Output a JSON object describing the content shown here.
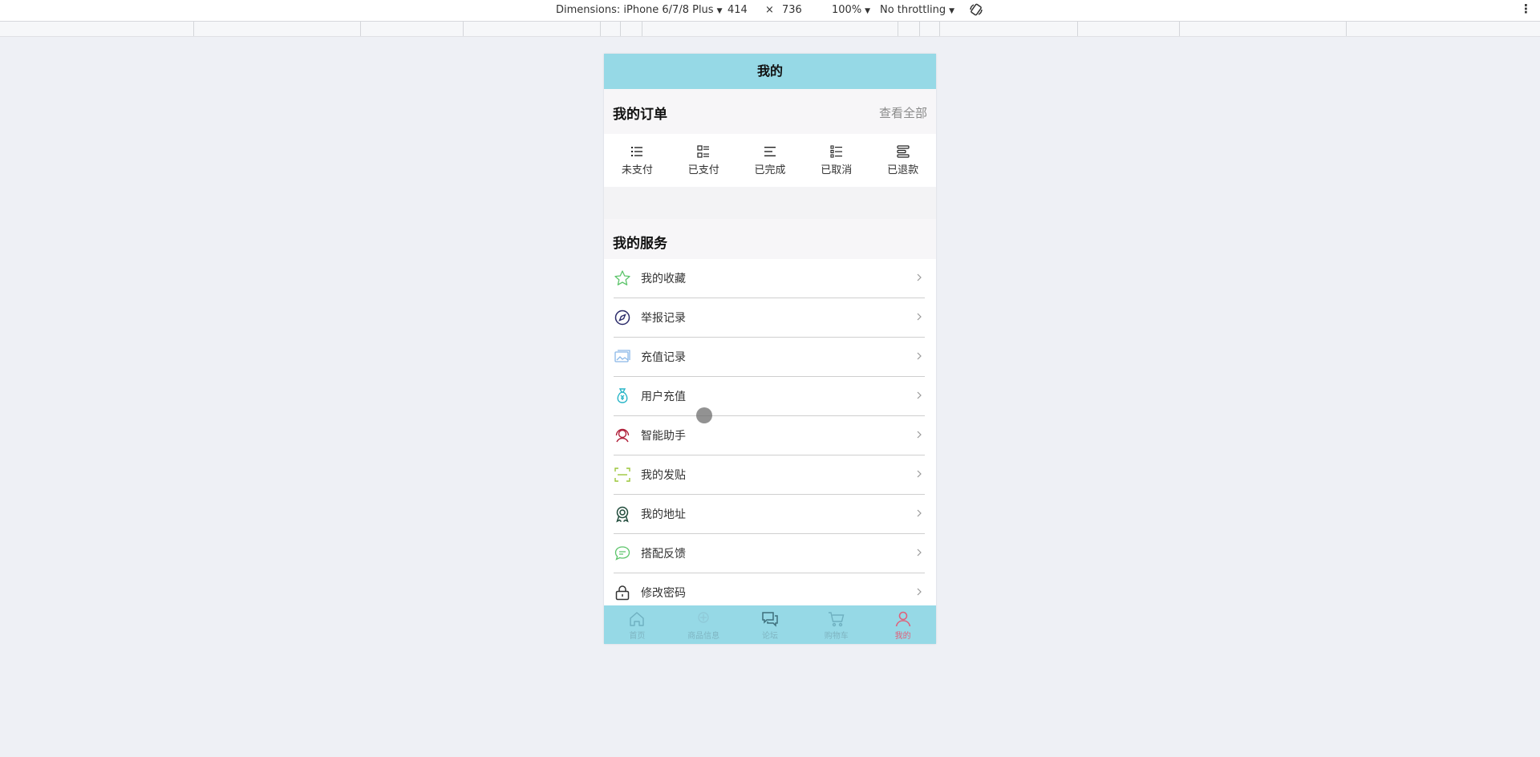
{
  "devtools": {
    "dimensions_label": "Dimensions: iPhone 6/7/8 Plus",
    "width": "414",
    "times": "×",
    "height": "736",
    "zoom": "100%",
    "throttling": "No throttling",
    "rotate_icon": "rotate-icon",
    "menu_icon": "more-vertical-icon"
  },
  "header": {
    "title": "我的"
  },
  "orders": {
    "title": "我的订单",
    "view_all": "查看全部",
    "items": [
      {
        "label": "未支付",
        "icon": "list-icon"
      },
      {
        "label": "已支付",
        "icon": "grid-list-icon"
      },
      {
        "label": "已完成",
        "icon": "align-left-icon"
      },
      {
        "label": "已取消",
        "icon": "checklist-icon"
      },
      {
        "label": "已退款",
        "icon": "stack-icon"
      }
    ]
  },
  "services": {
    "title": "我的服务",
    "items": [
      {
        "label": "我的收藏",
        "icon": "star-icon",
        "color": "#5cc46a"
      },
      {
        "label": "举报记录",
        "icon": "compass-icon",
        "color": "#2b2b6a"
      },
      {
        "label": "充值记录",
        "icon": "image-card-icon",
        "color": "#8ab8e8"
      },
      {
        "label": "用户充值",
        "icon": "money-bag-icon",
        "color": "#2ab6c8"
      },
      {
        "label": "智能助手",
        "icon": "agent-icon",
        "color": "#b0203a"
      },
      {
        "label": "我的发贴",
        "icon": "scan-icon",
        "color": "#9cc63a"
      },
      {
        "label": "我的地址",
        "icon": "badge-icon",
        "color": "#1f4a3a"
      },
      {
        "label": "搭配反馈",
        "icon": "chat-bubble-icon",
        "color": "#5cc46a"
      },
      {
        "label": "修改密码",
        "icon": "lock-icon",
        "color": "#333333"
      }
    ]
  },
  "tabs": [
    {
      "label": "首页",
      "icon": "home-icon",
      "active": false
    },
    {
      "label": "商品信息",
      "icon": "product-icon",
      "active": false
    },
    {
      "label": "论坛",
      "icon": "forum-icon",
      "active": false
    },
    {
      "label": "购物车",
      "icon": "cart-icon",
      "active": false
    },
    {
      "label": "我的",
      "icon": "user-icon",
      "active": true
    }
  ],
  "colors": {
    "nav_bg": "#96d9e6",
    "active_tab": "#e0607a",
    "page_bg": "#eef0f5"
  }
}
